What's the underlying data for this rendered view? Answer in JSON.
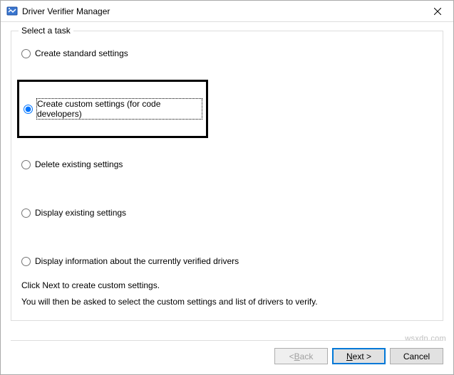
{
  "window": {
    "title": "Driver Verifier Manager"
  },
  "group": {
    "label": "Select a task"
  },
  "options": {
    "create_standard": "Create standard settings",
    "create_custom": "Create custom settings (for code developers)",
    "delete_existing": "Delete existing settings",
    "display_existing": "Display existing settings",
    "display_info": "Display information about the currently verified drivers"
  },
  "help": {
    "line1": "Click Next to create custom settings.",
    "line2": "You will then be asked to select the custom settings and list of drivers to verify."
  },
  "buttons": {
    "back_prefix": "< ",
    "back_access": "B",
    "back_suffix": "ack",
    "next_access": "N",
    "next_suffix": "ext >",
    "cancel": "Cancel"
  },
  "watermark": "wsxdn.com"
}
